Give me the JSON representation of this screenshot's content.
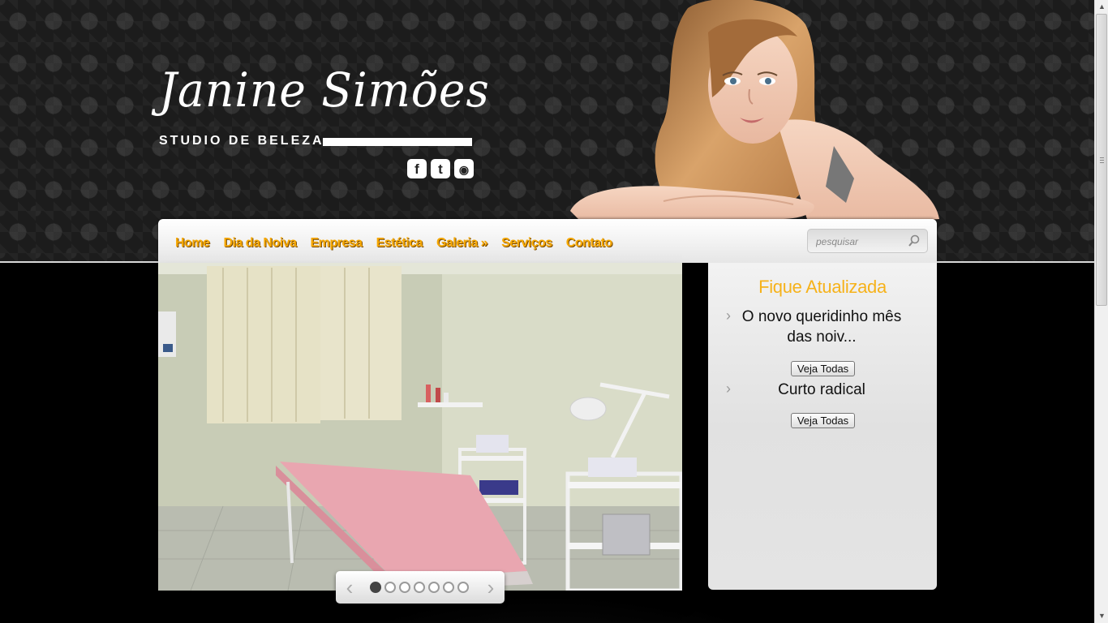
{
  "brand": {
    "name": "Janine Simões",
    "tagline": "STUDIO DE BELEZA"
  },
  "social": [
    {
      "icon": "facebook-icon",
      "glyph": "f"
    },
    {
      "icon": "twitter-icon",
      "glyph": "t"
    },
    {
      "icon": "rss-icon",
      "glyph": "◉"
    }
  ],
  "nav": {
    "items": [
      "Home",
      "Dia da Noiva",
      "Empresa",
      "Estética",
      "Galeria »",
      "Serviços",
      "Contato"
    ]
  },
  "search": {
    "placeholder": "pesquisar",
    "icon": "search-icon"
  },
  "slider": {
    "prev_glyph": "‹",
    "next_glyph": "›",
    "slide_count": 7,
    "active_index": 0
  },
  "news": {
    "title": "Fique Atualizada",
    "items": [
      {
        "text": "O novo queridinho mês das noiv...",
        "button": "Veja Todas"
      },
      {
        "text": "Curto radical",
        "button": "Veja Todas"
      }
    ]
  },
  "colors": {
    "accent": "#f6a800",
    "panel_title": "#f6b21a",
    "header_bg": "#1c1c1c"
  }
}
